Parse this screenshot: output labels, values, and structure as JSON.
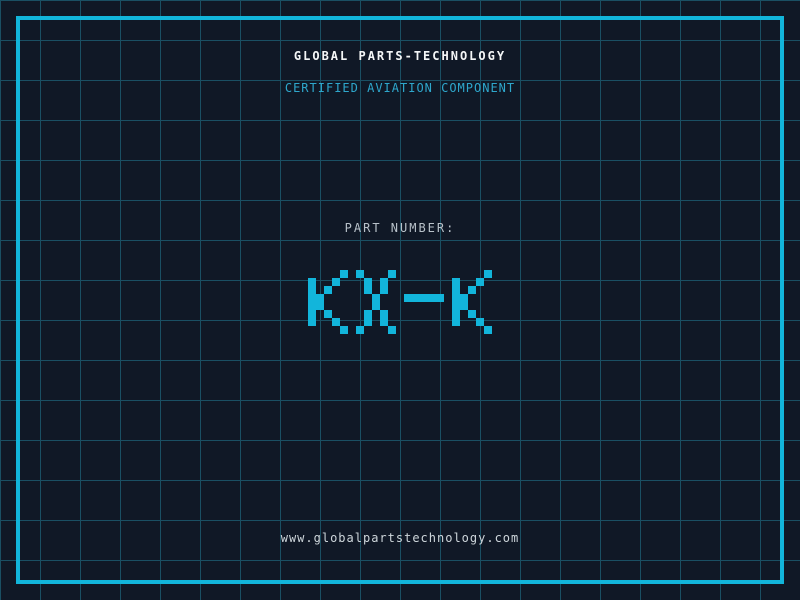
{
  "colors": {
    "background": "#101826",
    "grid_line": "#1a4f63",
    "frame": "#12b5db",
    "title_text": "#f4f6f7",
    "subtitle_text": "#2ea7cc",
    "part_label_text": "#b8c1c9",
    "part_number_text": "#12b5db",
    "url_text": "#ced6db"
  },
  "header": {
    "title": "GLOBAL PARTS-TECHNOLOGY",
    "subtitle": "CERTIFIED AVIATION COMPONENT"
  },
  "part": {
    "label": "PART NUMBER:",
    "value": "KX-K"
  },
  "footer": {
    "url": "www.globalpartstechnology.com"
  }
}
